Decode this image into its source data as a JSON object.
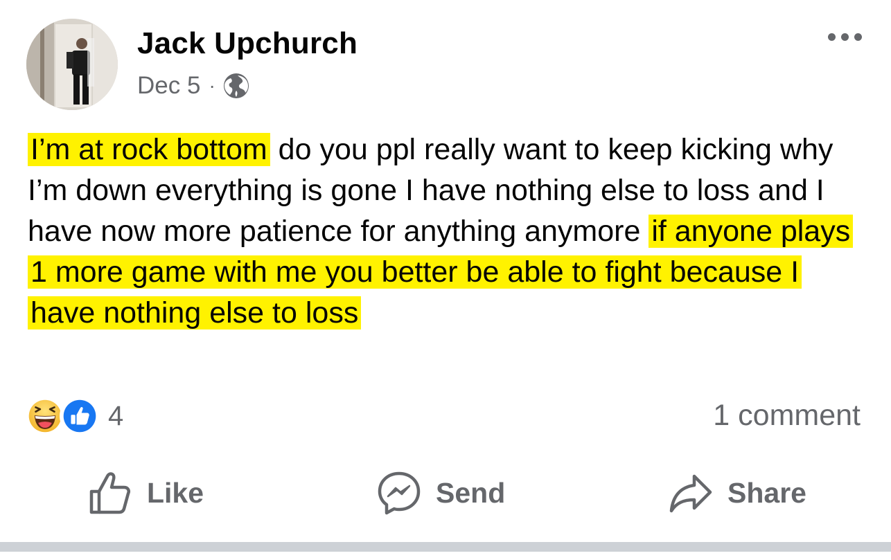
{
  "post": {
    "author": "Jack Upchurch",
    "date": "Dec 5",
    "separator": "·",
    "privacy_icon": "globe-icon",
    "more_icon": "more-options-icon",
    "text_segments": [
      {
        "text": "I’m at rock bottom",
        "highlight": true
      },
      {
        "text": " do you ppl really want to keep kicking why I’m down everything is gone I have nothing else to loss and I have now more patience for anything anymore ",
        "highlight": false
      },
      {
        "text": "if anyone plays 1 more game with me you better be able to fight because I have nothing else to loss ",
        "highlight": true
      }
    ],
    "highlight_color": "#fff200"
  },
  "reactions": {
    "icons": [
      "haha-icon",
      "like-icon"
    ],
    "count": "4",
    "comments_label": "1 comment"
  },
  "actions": {
    "like_label": "Like",
    "send_label": "Send",
    "share_label": "Share"
  },
  "colors": {
    "text": "#050505",
    "secondary": "#65676b",
    "like_blue": "#1877f2",
    "haha_yellow": "#f7c948"
  }
}
